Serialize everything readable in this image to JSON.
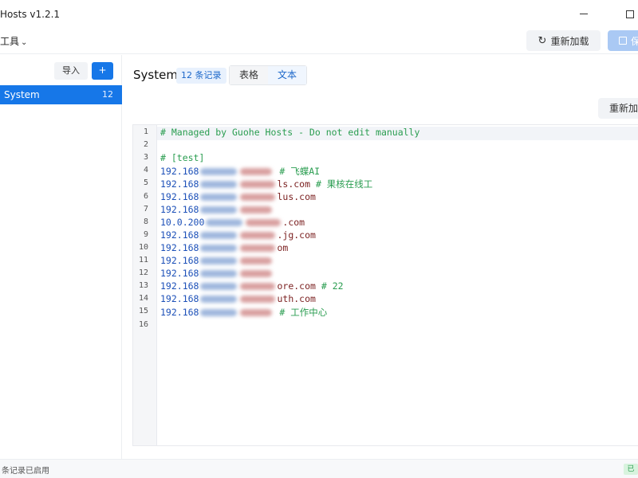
{
  "window": {
    "title": "Hosts v1.2.1"
  },
  "toolbar": {
    "tools_label": "工具",
    "reload_label": "重新加载",
    "save_label": "保"
  },
  "sidebar": {
    "import_label": "导入",
    "add_label": "+",
    "items": [
      {
        "label": "System",
        "count": "12"
      }
    ]
  },
  "main": {
    "title": "System",
    "record_badge": "12 条记录",
    "tabs": [
      {
        "label": "表格",
        "active": false
      },
      {
        "label": "文本",
        "active": true
      }
    ],
    "reload_label": "重新加载"
  },
  "editor": {
    "lines": [
      {
        "num": "1",
        "comment": "# Managed by Guohe Hosts - Do not edit manually"
      },
      {
        "num": "2"
      },
      {
        "num": "3",
        "comment": "# [test]"
      },
      {
        "num": "4",
        "ip": "192.168",
        "comment": "# 飞蝶AI"
      },
      {
        "num": "5",
        "ip": "192.168",
        "host": "ls.com",
        "comment": "# 果核在线工"
      },
      {
        "num": "6",
        "ip": "192.168",
        "host": "lus.com"
      },
      {
        "num": "7",
        "ip": "192.168"
      },
      {
        "num": "8",
        "ip": "10.0.200",
        "host": ".com"
      },
      {
        "num": "9",
        "ip": "192.168",
        "host": ".jg.com"
      },
      {
        "num": "10",
        "ip": "192.168",
        "host": "om"
      },
      {
        "num": "11",
        "ip": "192.168"
      },
      {
        "num": "12",
        "ip": "192.168"
      },
      {
        "num": "13",
        "ip": "192.168",
        "host": "ore.com",
        "comment": "# 22"
      },
      {
        "num": "14",
        "ip": "192.168",
        "host": "uth.com"
      },
      {
        "num": "15",
        "ip": "192.168",
        "comment": "# 工作中心"
      },
      {
        "num": "16"
      }
    ]
  },
  "statusbar": {
    "text": "条记录已启用",
    "badge": "已"
  },
  "colors": {
    "accent": "#1677e8",
    "comment": "#2a9d50",
    "ip": "#1c50b8",
    "host": "#7a1f1f"
  }
}
